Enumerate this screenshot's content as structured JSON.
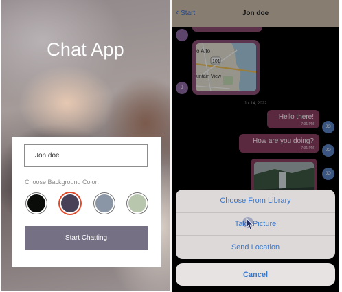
{
  "start_screen": {
    "title": "Chat App",
    "name_input": {
      "value": "Jon doe"
    },
    "bg_label": "Choose Background Color:",
    "colors": [
      "#090C08",
      "#474056",
      "#8A95A5",
      "#B9C6AE"
    ],
    "selected_color_index": 1,
    "start_button": "Start Chatting"
  },
  "chat_screen": {
    "back_label": "Start",
    "title": "Jon doe",
    "map_labels": {
      "place1": "o Alto",
      "route": "101",
      "place2": "untain View"
    },
    "date": "Jul 14, 2022",
    "messages": [
      {
        "text": "Hello there!",
        "time": "7:31 PM",
        "avatar": "JO"
      },
      {
        "text": "How are you doing?",
        "time": "7:31 PM",
        "avatar": "JO"
      }
    ],
    "photo_avatar": "JO",
    "received_avatar": "J",
    "action_sheet": {
      "items": [
        "Choose From Library",
        "Take Picture",
        "Send Location"
      ],
      "cancel": "Cancel"
    }
  }
}
